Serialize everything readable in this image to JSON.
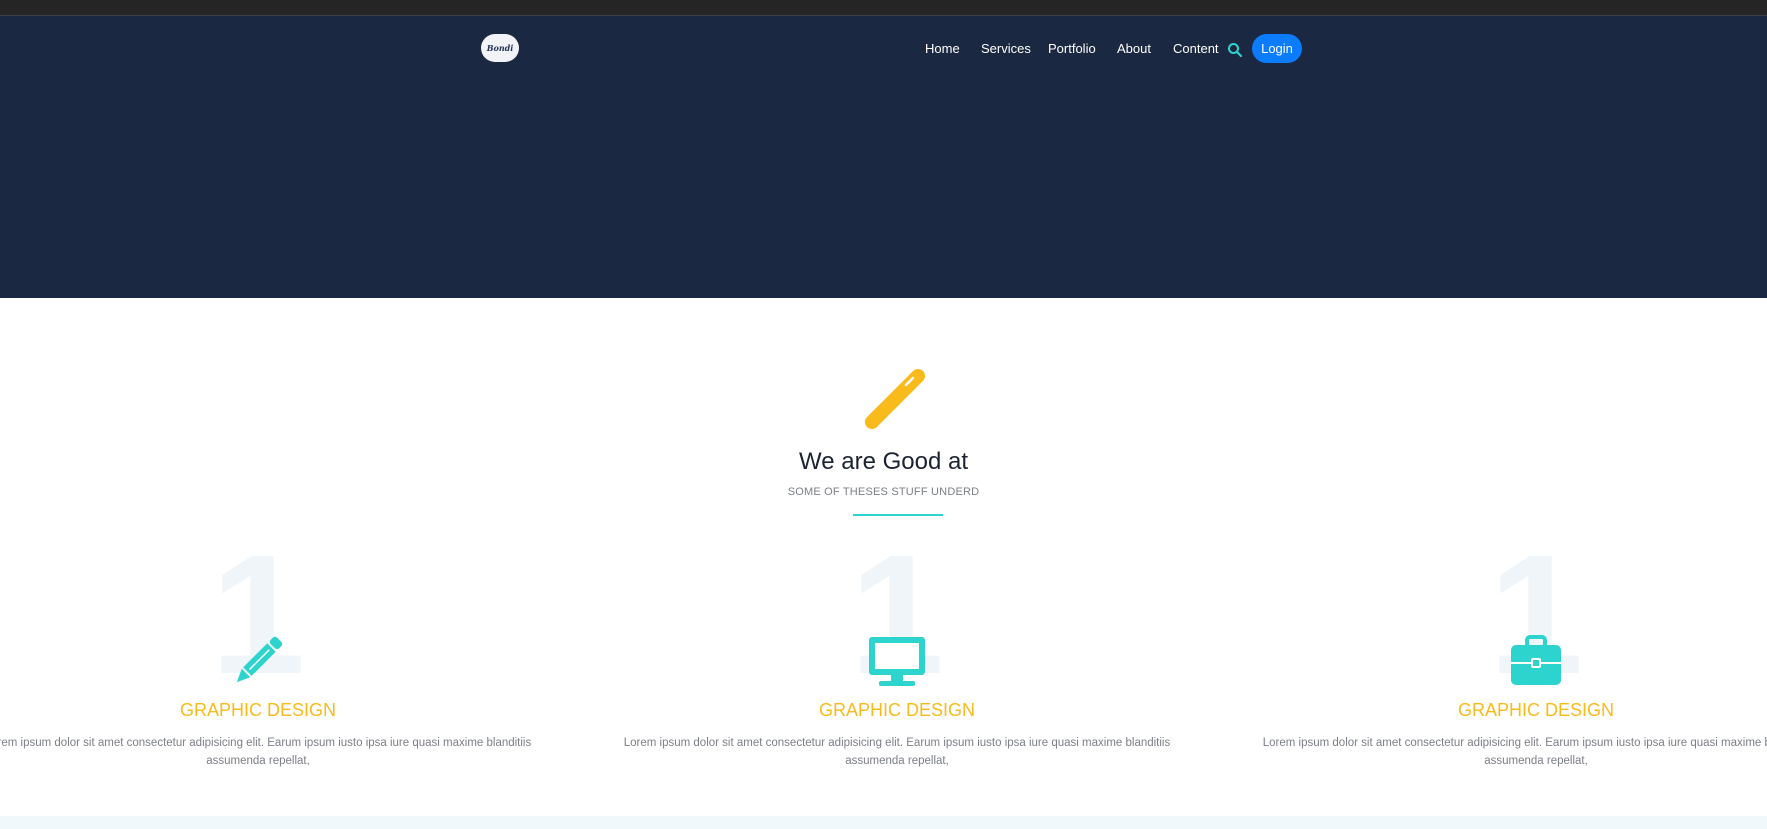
{
  "header": {
    "logo_text": "Bondi",
    "nav": [
      "Home",
      "Services",
      "Portfolio",
      "About",
      "Content"
    ],
    "search_icon": "search-icon",
    "login_label": "Login"
  },
  "section": {
    "icon": "magic-wand-icon",
    "title": "We are Good at",
    "subtitle": "SOME OF THESES STUFF UNDERD"
  },
  "cards": [
    {
      "number": "1",
      "icon": "pencil-icon",
      "title": "GRAPHIC DESIGN",
      "desc": "Lorem ipsum dolor sit amet consectetur adipisicing elit. Earum ipsum iusto ipsa iure quasi maxime blanditiis assumenda repellat,"
    },
    {
      "number": "1",
      "icon": "monitor-icon",
      "title": "GRAPHIC DESIGN",
      "desc": "Lorem ipsum dolor sit amet consectetur adipisicing elit. Earum ipsum iusto ipsa iure quasi maxime blanditiis assumenda repellat,"
    },
    {
      "number": "1",
      "icon": "briefcase-icon",
      "title": "GRAPHIC DESIGN",
      "desc": "Lorem ipsum dolor sit amet consectetur adipisicing elit. Earum ipsum iusto ipsa iure quasi maxime blanditiis assumenda repellat,"
    }
  ],
  "colors": {
    "hero_bg": "#1b2841",
    "accent_teal": "#2dd4cd",
    "accent_yellow": "#f9bb1c",
    "login_blue": "#0c7cff"
  }
}
